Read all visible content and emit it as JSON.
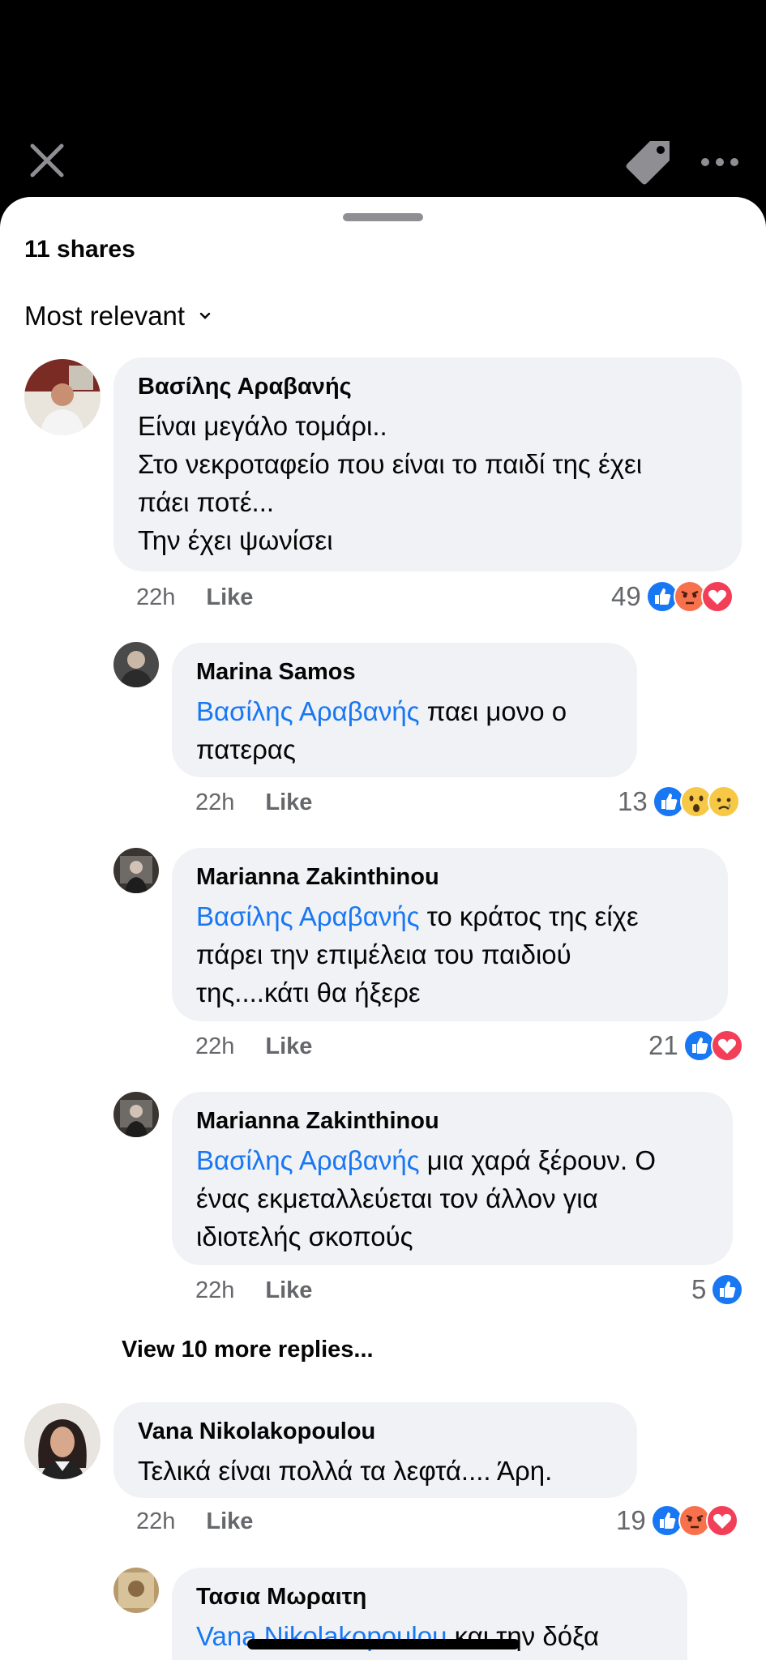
{
  "header": {
    "close_icon": "close-icon",
    "tag_icon": "tag-icon",
    "more_icon": "more-icon"
  },
  "sheet": {
    "shares_label": "11 shares",
    "sort_label": "Most relevant",
    "view_more_label": "View 10 more replies..."
  },
  "comments": [
    {
      "author": "Βασίλης Αραβανής",
      "lines": [
        "Είναι μεγάλο τομάρι..",
        "Στο νεκροταφείο που είναι το παιδί της έχει",
        "πάει ποτέ...",
        "Την έχει ψωνίσει"
      ],
      "time": "22h",
      "like_label": "Like",
      "reaction_count": "49",
      "reactions": [
        "like",
        "angry",
        "love"
      ]
    },
    {
      "author": "Marina Samos",
      "mention": "Βασίλης Αραβανής",
      "lines": [
        " παει μονο ο",
        "πατερας"
      ],
      "time": "22h",
      "like_label": "Like",
      "reaction_count": "13",
      "reactions": [
        "like",
        "wow",
        "sad"
      ]
    },
    {
      "author": "Marianna Zakinthinou",
      "mention": "Βασίλης Αραβανής",
      "lines": [
        " το κράτος της είχε",
        "πάρει την επιμέλεια του παιδιού",
        "της....κάτι θα ήξερε"
      ],
      "time": "22h",
      "like_label": "Like",
      "reaction_count": "21",
      "reactions": [
        "like",
        "love"
      ]
    },
    {
      "author": "Marianna Zakinthinou",
      "mention": "Βασίλης Αραβανής",
      "lines": [
        " μια χαρά ξέρουν. Ο",
        "ένας εκμεταλλεύεται τον άλλον για",
        "ιδιοτελής σκοπούς"
      ],
      "time": "22h",
      "like_label": "Like",
      "reaction_count": "5",
      "reactions": [
        "like"
      ]
    },
    {
      "author": "Vana Nikolakopoulou",
      "lines": [
        "Τελικά είναι πολλά τα λεφτά.... Άρη."
      ],
      "time": "22h",
      "like_label": "Like",
      "reaction_count": "19",
      "reactions": [
        "like",
        "angry",
        "love"
      ]
    },
    {
      "author": "Τασια Μωραιτη",
      "mention": "Vana Nikolakopoulou",
      "lines": [
        " και την δόξα"
      ]
    }
  ],
  "colors": {
    "accent": "#1877f2",
    "love": "#f33e58",
    "bubble": "#f0f2f5"
  }
}
